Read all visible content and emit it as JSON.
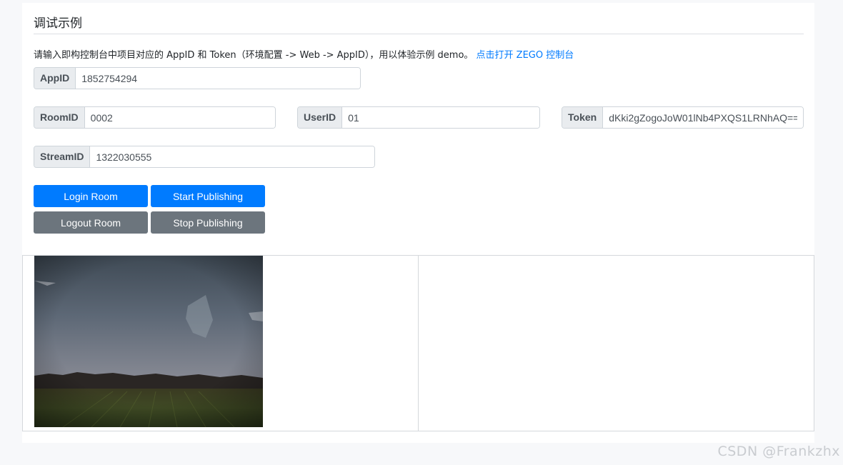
{
  "page": {
    "title": "调试示例",
    "instruction_text": "请输入即构控制台中项目对应的 AppID 和 Token（环境配置 -> Web -> AppID），用以体验示例 demo。",
    "instruction_link": "点击打开 ZEGO 控制台"
  },
  "fields": {
    "appid": {
      "label": "AppID",
      "value": "1852754294"
    },
    "roomid": {
      "label": "RoomID",
      "value": "0002"
    },
    "userid": {
      "label": "UserID",
      "value": "01"
    },
    "token": {
      "label": "Token",
      "value": "dKki2gZogoJoW01lNb4PXQS1LRNhAQ=="
    },
    "streamid": {
      "label": "StreamID",
      "value": "1322030555"
    }
  },
  "buttons": {
    "login": "Login Room",
    "start_publishing": "Start Publishing",
    "logout": "Logout Room",
    "stop_publishing": "Stop Publishing"
  },
  "watermark": "CSDN @Frankzhx",
  "colors": {
    "primary": "#007bff",
    "secondary": "#6c757d",
    "link": "#007bff"
  }
}
